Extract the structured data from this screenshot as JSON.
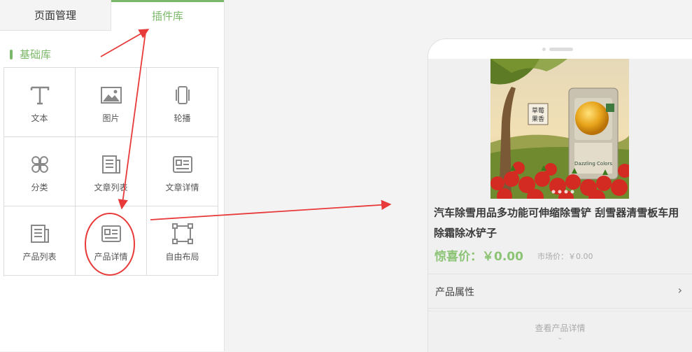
{
  "tabs": {
    "page_manage": "页面管理",
    "plugin_lib": "插件库"
  },
  "section": {
    "title": "基础库"
  },
  "widgets": [
    {
      "label": "文本",
      "icon": "text-icon"
    },
    {
      "label": "图片",
      "icon": "image-icon"
    },
    {
      "label": "轮播",
      "icon": "carousel-icon"
    },
    {
      "label": "分类",
      "icon": "category-icon"
    },
    {
      "label": "文章列表",
      "icon": "article-list-icon"
    },
    {
      "label": "文章详情",
      "icon": "article-detail-icon"
    },
    {
      "label": "产品列表",
      "icon": "product-list-icon"
    },
    {
      "label": "产品详情",
      "icon": "product-detail-icon"
    },
    {
      "label": "自由布局",
      "icon": "free-layout-icon"
    }
  ],
  "preview": {
    "product_title": "汽车除雪用品多功能可伸缩除雪铲 刮雪器清雪板车用除霜除冰铲子",
    "price_label": "惊喜价：￥0.00",
    "market_price": "市场价：￥0.00",
    "attributes_label": "产品属性",
    "attributes_chevron": "›",
    "view_detail": "查看产品详情",
    "view_detail_chevron": "⌄",
    "image_text": {
      "brand_cn": "草莓果香",
      "brand_en": "Dazzling Colors"
    }
  },
  "colors": {
    "accent": "#7cb86a",
    "price": "#8cc476",
    "annotation": "#e83a3a"
  }
}
